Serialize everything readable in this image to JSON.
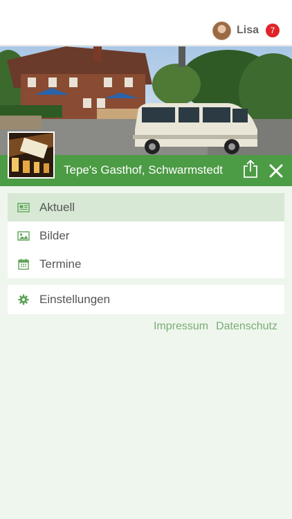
{
  "user": {
    "name": "Lisa",
    "notification_count": "7"
  },
  "venue": {
    "title": "Tepe's Gasthof, Schwarmstedt"
  },
  "menu": {
    "items": [
      {
        "label": "Aktuell",
        "icon": "newspaper-icon",
        "active": true
      },
      {
        "label": "Bilder",
        "icon": "image-icon",
        "active": false
      },
      {
        "label": "Termine",
        "icon": "calendar-icon",
        "active": false
      }
    ],
    "settings": {
      "label": "Einstellungen",
      "icon": "gear-icon"
    }
  },
  "footer_links": {
    "impressum": "Impressum",
    "datenschutz": "Datenschutz"
  },
  "colors": {
    "accent": "#4c9b45",
    "active_bg": "#d7e9d5",
    "link": "#78ad74",
    "badge": "#e0242a",
    "icon": "#5fa258"
  }
}
